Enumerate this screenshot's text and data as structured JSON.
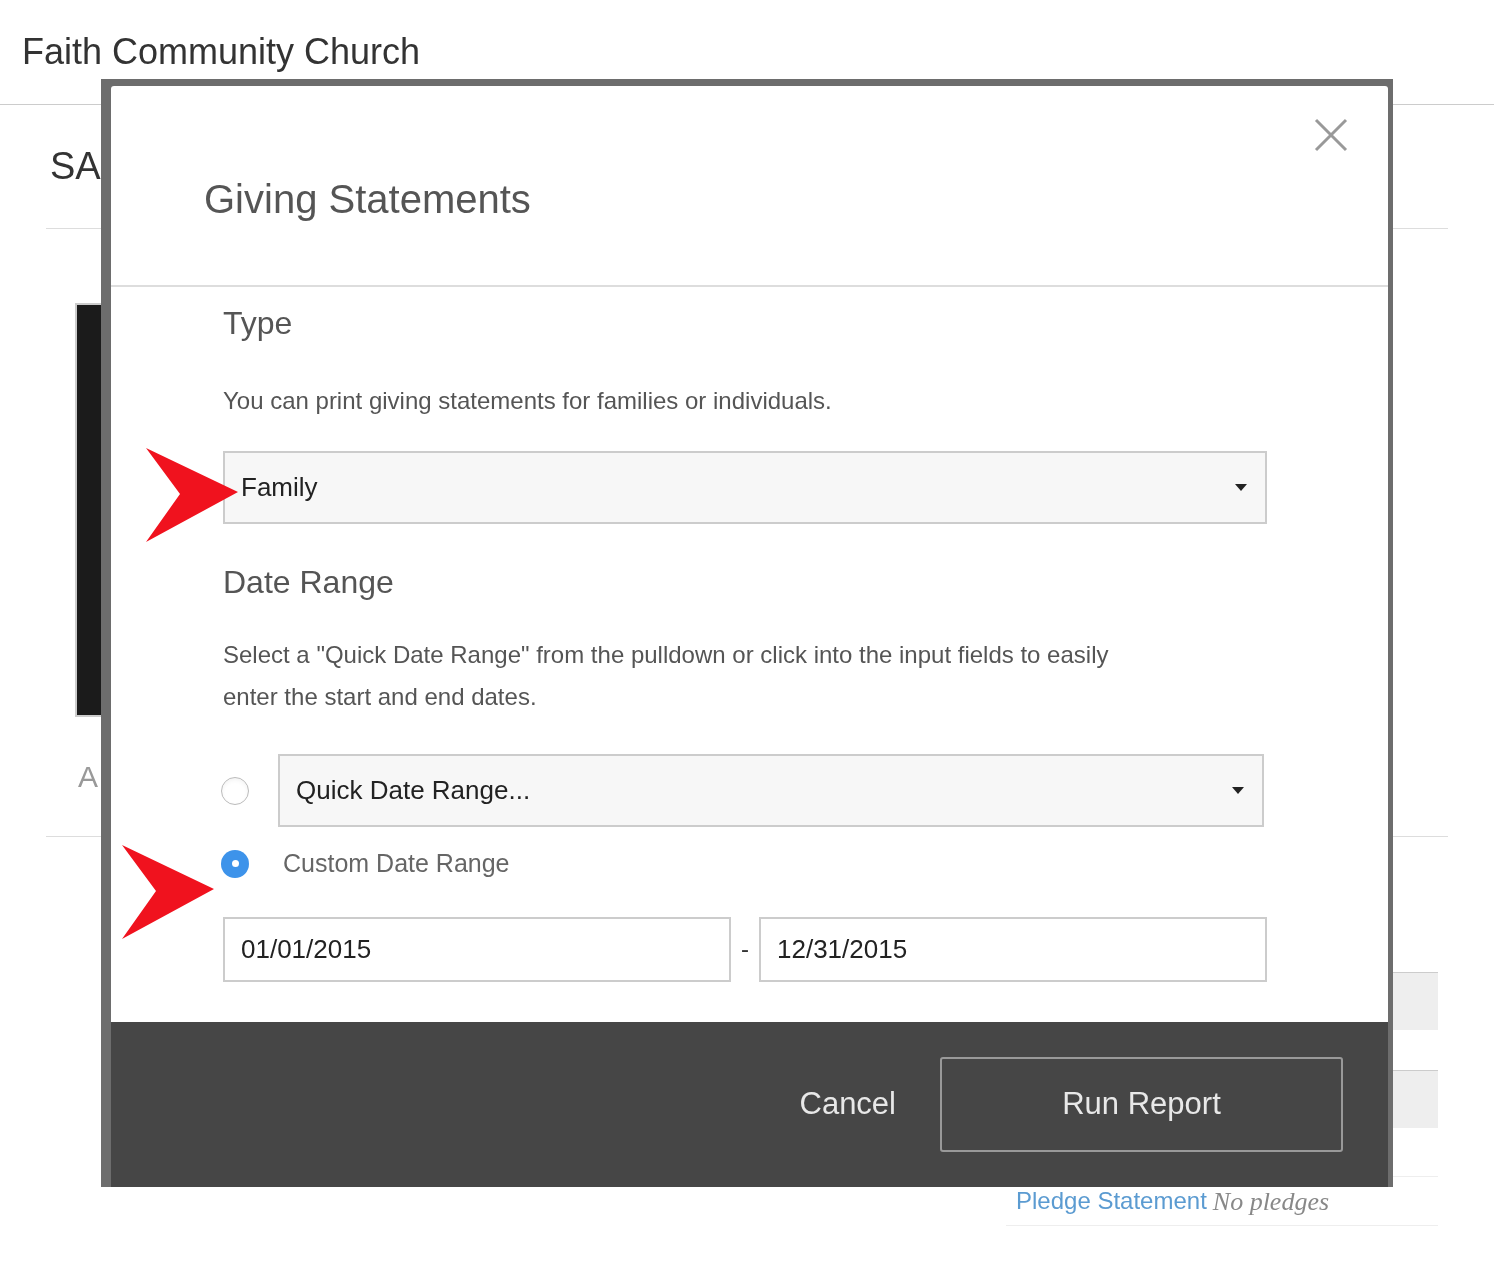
{
  "header": {
    "title": "Faith Community Church"
  },
  "background": {
    "heading": "SA",
    "label": "A",
    "link": "Pledge Statement",
    "note": "No pledges"
  },
  "modal": {
    "title": "Giving Statements",
    "type_section": {
      "heading": "Type",
      "description": "You can print giving statements for families or individuals.",
      "select_value": "Family"
    },
    "date_section": {
      "heading": "Date Range",
      "description": "Select a \"Quick Date Range\" from the pulldown or click into the input fields to easily enter the start and end dates.",
      "options": [
        {
          "kind": "select",
          "value": "Quick Date Range...",
          "selected": false
        },
        {
          "kind": "label",
          "label": "Custom Date Range",
          "selected": true
        }
      ],
      "start_date": "01/01/2015",
      "separator": "-",
      "end_date": "12/31/2015"
    },
    "buttons": [
      {
        "kind": "link",
        "label": "Cancel"
      },
      {
        "kind": "outline",
        "label": "Run Report"
      }
    ]
  }
}
